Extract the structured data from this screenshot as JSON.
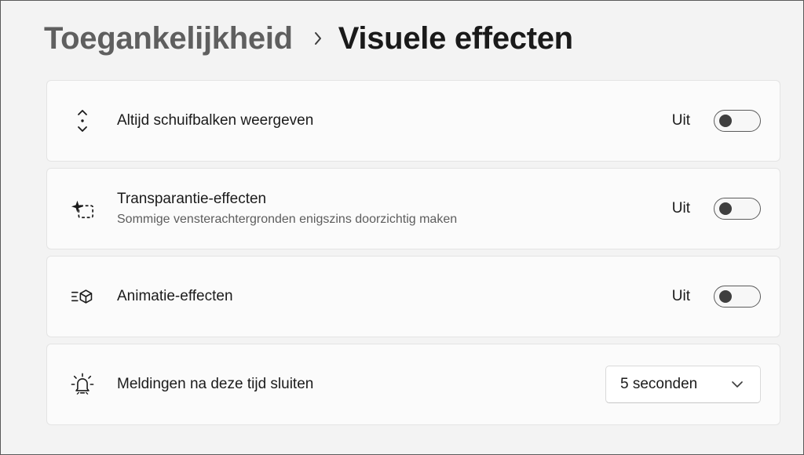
{
  "breadcrumb": {
    "parent": "Toegankelijkheid",
    "separator_icon": "chevron-right-icon",
    "current": "Visuele effecten"
  },
  "settings": [
    {
      "icon": "scrollbar-arrows-icon",
      "title": "Altijd schuifbalken weergeven",
      "control": "toggle",
      "state_label": "Uit",
      "on": false
    },
    {
      "icon": "transparency-sparkle-icon",
      "title": "Transparantie-effecten",
      "subtitle": "Sommige vensterachtergronden enigszins doorzichtig maken",
      "control": "toggle",
      "state_label": "Uit",
      "on": false
    },
    {
      "icon": "animation-cube-icon",
      "title": "Animatie-effecten",
      "control": "toggle",
      "state_label": "Uit",
      "on": false
    },
    {
      "icon": "notification-bell-icon",
      "title": "Meldingen na deze tijd sluiten",
      "control": "dropdown",
      "selected": "5 seconden"
    }
  ],
  "colors": {
    "background": "#f3f3f3",
    "card": "#fbfbfb",
    "toggle_knob": "#3f3f3f"
  }
}
